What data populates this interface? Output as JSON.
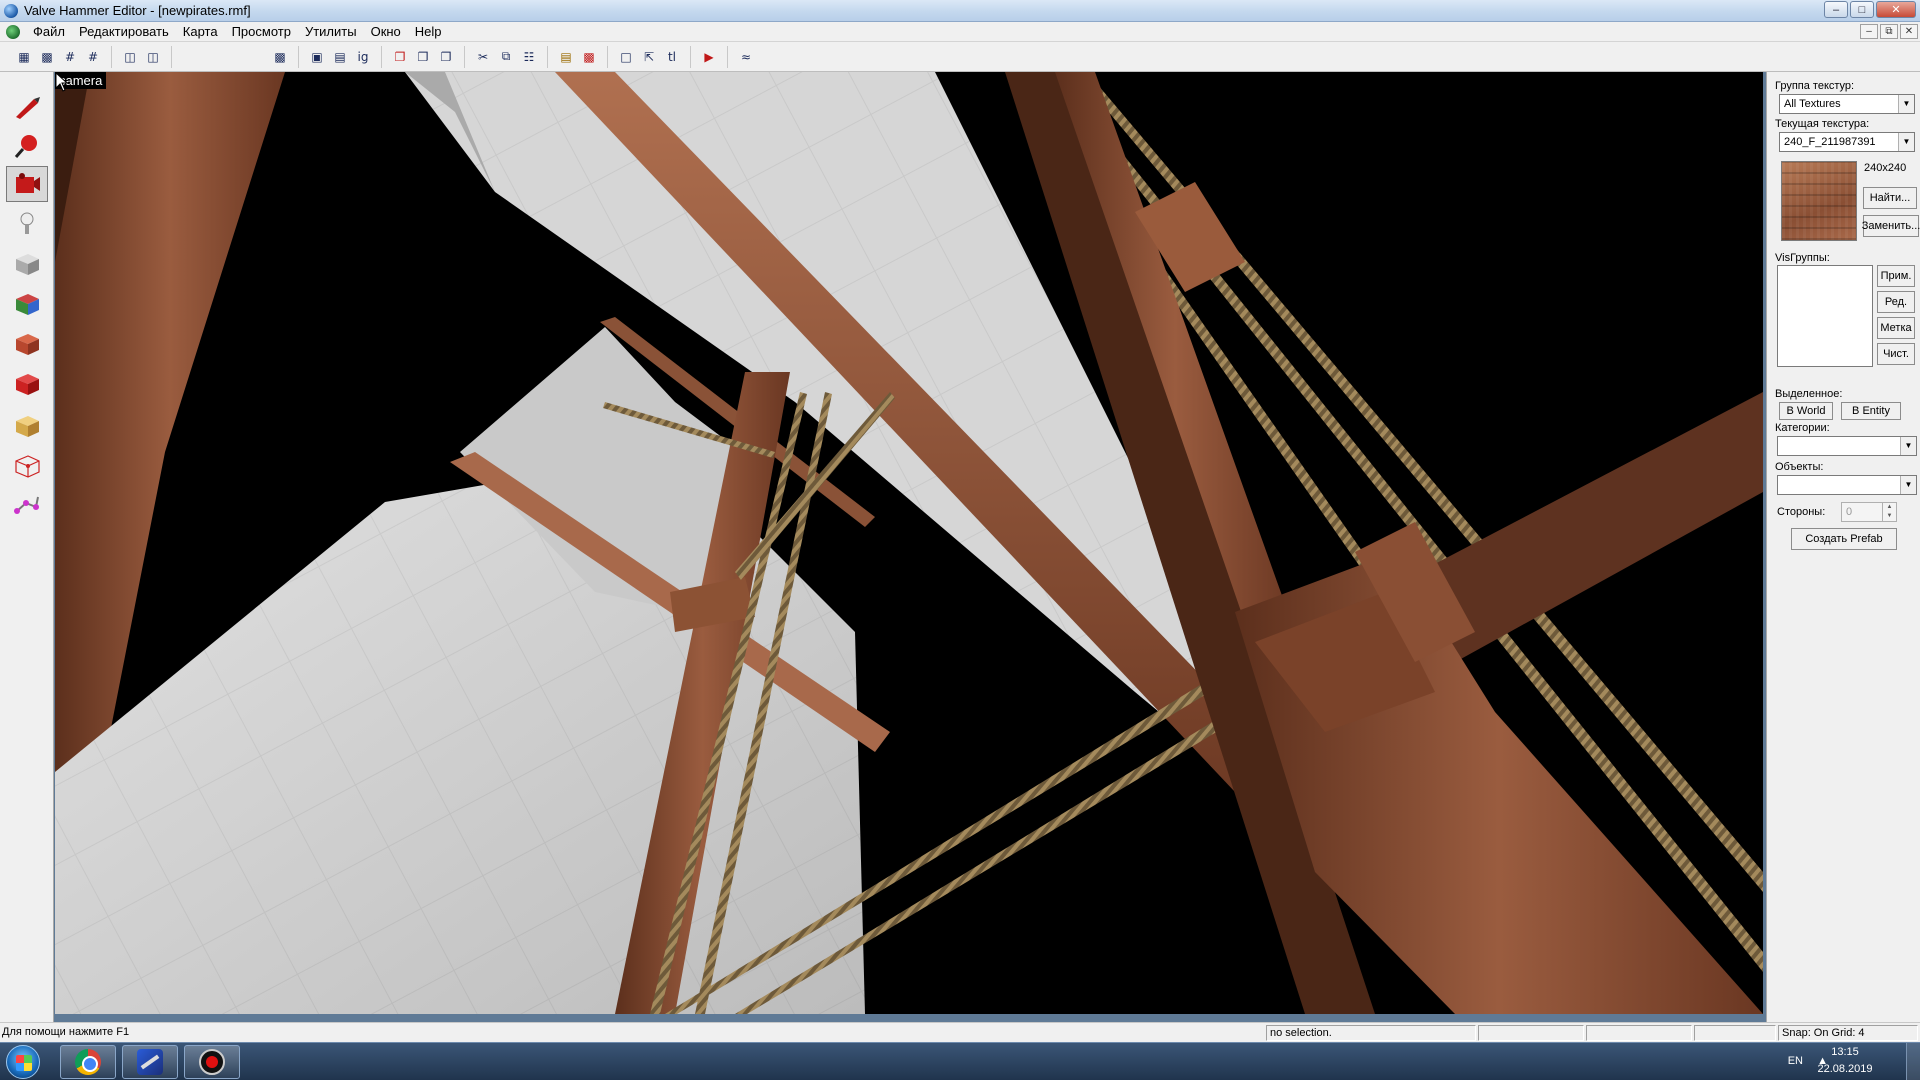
{
  "window": {
    "title": "Valve Hammer Editor - [newpirates.rmf]"
  },
  "menu": [
    "Файл",
    "Редактировать",
    "Карта",
    "Просмотр",
    "Утилиты",
    "Окно",
    "Help"
  ],
  "toolbar": {
    "groups": [
      [
        "grid-icon",
        "grid-snap-icon",
        "grid-smaller-icon",
        "grid-larger-icon"
      ],
      [
        "map-info-icon",
        "entity-report-icon"
      ],
      [
        "texture-app-icon"
      ],
      [
        "group-icon",
        "ungroup-icon",
        "ignore-group-icon"
      ],
      [
        "carve-icon",
        "hollow-icon",
        "clip-icon"
      ],
      [
        "cut-icon",
        "copy-icon",
        "paste-icon"
      ],
      [
        "texture-lock-icon",
        "texture-lock-scale-icon"
      ],
      [
        "select-all-icon",
        "selection-icon",
        "tie-to-entity-icon"
      ],
      [
        "run-map-icon"
      ],
      [
        "zoom-icon"
      ]
    ]
  },
  "tools": [
    {
      "name": "selection-tool",
      "icon": "pointer-icon",
      "active": false
    },
    {
      "name": "magnify-tool",
      "icon": "magnify-icon",
      "active": false
    },
    {
      "name": "camera-tool",
      "icon": "camera-icon",
      "active": true
    },
    {
      "name": "entity-tool",
      "icon": "entity-icon",
      "active": false
    },
    {
      "name": "block-tool",
      "icon": "block-icon",
      "active": false
    },
    {
      "name": "texture-tool",
      "icon": "texture-icon",
      "active": false
    },
    {
      "name": "apply-texture-tool",
      "icon": "apply-texture-icon",
      "active": false
    },
    {
      "name": "decal-tool",
      "icon": "decal-icon",
      "active": false
    },
    {
      "name": "clip-tool",
      "icon": "clip-icon",
      "active": false
    },
    {
      "name": "vertex-tool",
      "icon": "vertex-icon",
      "active": false
    },
    {
      "name": "path-tool",
      "icon": "path-icon",
      "active": false
    }
  ],
  "viewport": {
    "label": "camera"
  },
  "texture_panel": {
    "group_label": "Группа текстур:",
    "group_value": "All Textures",
    "current_label": "Текущая текстура:",
    "current_value": "240_F_211987391",
    "size": "240x240",
    "find_button": "Найти...",
    "replace_button": "Заменить...",
    "visgroups_label": "VisГруппы:",
    "vis_buttons": [
      "Прим.",
      "Ред.",
      "Метка",
      "Чист."
    ],
    "selected_label": "Выделенное:",
    "to_world": "В World",
    "to_entity": "В Entity",
    "categories_label": "Категории:",
    "objects_label": "Объекты:",
    "sides_label": "Стороны:",
    "sides_value": "0",
    "create_prefab": "Создать Prefab"
  },
  "status": {
    "help": "Для помощи нажмите F1",
    "selection": "no selection.",
    "snap": "Snap: On Grid: 4"
  },
  "taskbar": {
    "apps": [
      "chrome-icon",
      "hammer-icon",
      "record-icon"
    ],
    "lang": "EN",
    "time": "13:15",
    "date": "22.08.2019"
  },
  "colors": {
    "viewport_bg": "#000000",
    "wood": "#8a4f34",
    "sail": "#d9d9d9",
    "rope": "#8c7650"
  }
}
